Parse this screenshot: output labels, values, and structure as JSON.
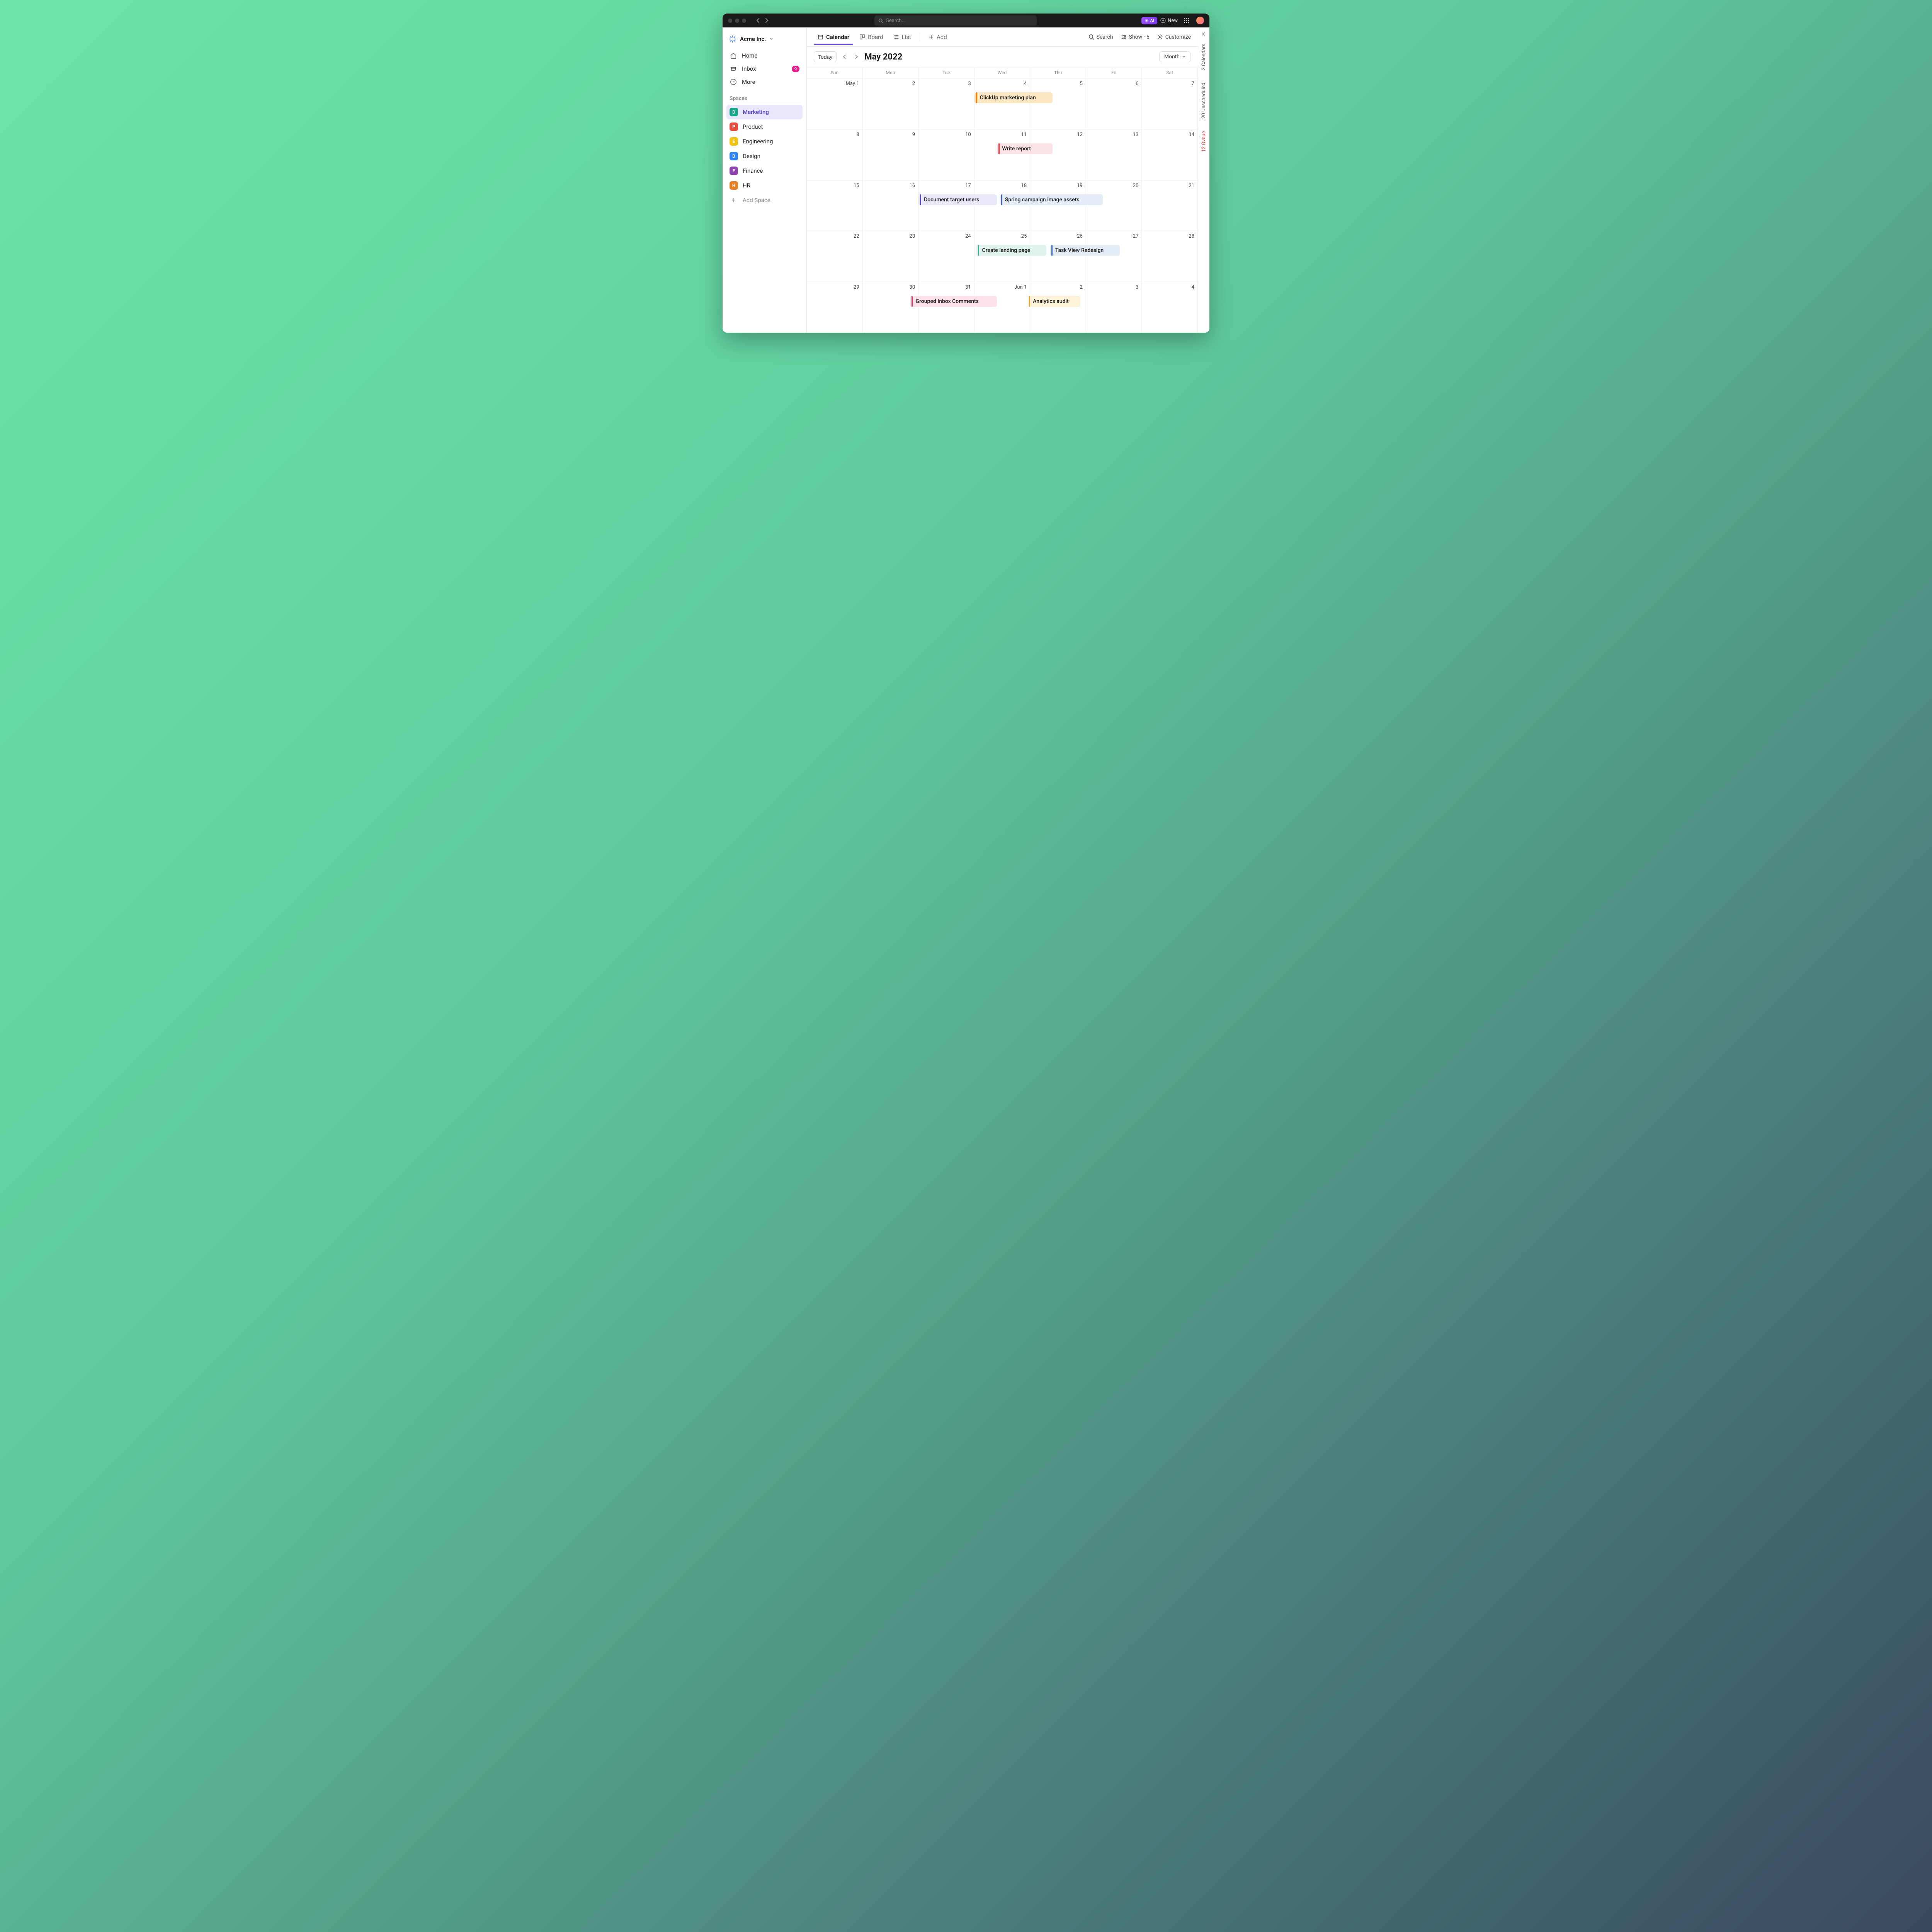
{
  "titlebar": {
    "search_placeholder": "Search...",
    "ai_label": "AI",
    "new_label": "New"
  },
  "sidebar": {
    "workspace_name": "Acme Inc.",
    "nav": {
      "home": "Home",
      "inbox": "Inbox",
      "inbox_badge": "9",
      "more": "More"
    },
    "spaces_label": "Spaces",
    "spaces": [
      {
        "letter": "D",
        "label": "Marketing",
        "color": "#17a589",
        "active": true
      },
      {
        "letter": "P",
        "label": "Product",
        "color": "#e74c3c",
        "active": false
      },
      {
        "letter": "E",
        "label": "Engineering",
        "color": "#f1c40f",
        "active": false
      },
      {
        "letter": "D",
        "label": "Design",
        "color": "#2e86f5",
        "active": false
      },
      {
        "letter": "F",
        "label": "Finance",
        "color": "#8e44ad",
        "active": false
      },
      {
        "letter": "H",
        "label": "HR",
        "color": "#e67e22",
        "active": false
      }
    ],
    "add_space_label": "Add Space"
  },
  "toolbar": {
    "views": {
      "calendar": "Calendar",
      "board": "Board",
      "list": "List",
      "add": "Add"
    },
    "search_label": "Search",
    "show_label": "Show · 5",
    "customize_label": "Customize"
  },
  "calendar": {
    "today_label": "Today",
    "title": "May 2022",
    "month_label": "Month",
    "dow": [
      "Sun",
      "Mon",
      "Tue",
      "Wed",
      "Thu",
      "Fri",
      "Sat"
    ],
    "weeks": [
      [
        "May 1",
        "2",
        "3",
        "4",
        "5",
        "6",
        "7"
      ],
      [
        "8",
        "9",
        "10",
        "11",
        "12",
        "13",
        "14"
      ],
      [
        "15",
        "16",
        "17",
        "18",
        "19",
        "20",
        "21"
      ],
      [
        "22",
        "23",
        "24",
        "25",
        "26",
        "27",
        "28"
      ],
      [
        "29",
        "30",
        "31",
        "Jun 1",
        "2",
        "3",
        "4"
      ]
    ],
    "events": [
      {
        "week": 0,
        "start": 3,
        "span": 1.4,
        "label": "ClickUp marketing plan",
        "bg": "#fde7c3",
        "stripe": "#ff7a00"
      },
      {
        "week": 1,
        "start": 3.4,
        "span": 1.0,
        "label": "Write report",
        "bg": "#fbe3e6",
        "stripe": "#e53946"
      },
      {
        "week": 2,
        "start": 2,
        "span": 1.4,
        "label": "Document target users",
        "bg": "#e9e8f9",
        "stripe": "#5b3fd9"
      },
      {
        "week": 2,
        "start": 3.45,
        "span": 1.85,
        "label": "Spring campaign image assets",
        "bg": "#e5ecf7",
        "stripe": "#3563d9"
      },
      {
        "week": 3,
        "start": 3.04,
        "span": 1.25,
        "label": "Create landing page",
        "bg": "#dff3ee",
        "stripe": "#2fb89a"
      },
      {
        "week": 3,
        "start": 4.35,
        "span": 1.25,
        "label": "Task View Redesign",
        "bg": "#e3edf8",
        "stripe": "#2b6fe0"
      },
      {
        "week": 4,
        "start": 1.85,
        "span": 1.55,
        "label": "Grouped Inbox Comments",
        "bg": "#fce2e8",
        "stripe": "#e0317a"
      },
      {
        "week": 4,
        "start": 3.95,
        "span": 0.95,
        "label": "Analytics audit",
        "bg": "#fdf3d8",
        "stripe": "#f0a31e"
      }
    ]
  },
  "right_rail": {
    "calendars": "2 Calendars",
    "unscheduled": "20 Unscheduled",
    "overdue": "12 Ovdue"
  }
}
